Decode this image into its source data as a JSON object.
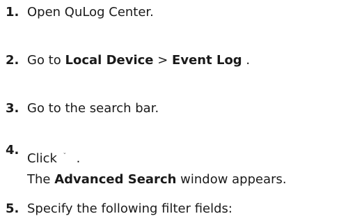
{
  "steps": [
    {
      "number": "1.",
      "text": "Open QuLog Center."
    },
    {
      "number": "2.",
      "prefix": "Go to ",
      "bold1": "Local Device",
      "sep": " > ",
      "bold2": "Event Log",
      "suffix": " ."
    },
    {
      "number": "3.",
      "text": "Go to the search bar."
    },
    {
      "number": "4.",
      "click_label": "Click",
      "icon": "caret-down-icon",
      "icon_glyph": "ˇ",
      "after_icon": " .",
      "line2_bold": "Advanced Search",
      "line2_rest": " window appears.",
      "line2_prefix": "The "
    },
    {
      "number": "5.",
      "text": "Specify the following filter fields:"
    }
  ]
}
